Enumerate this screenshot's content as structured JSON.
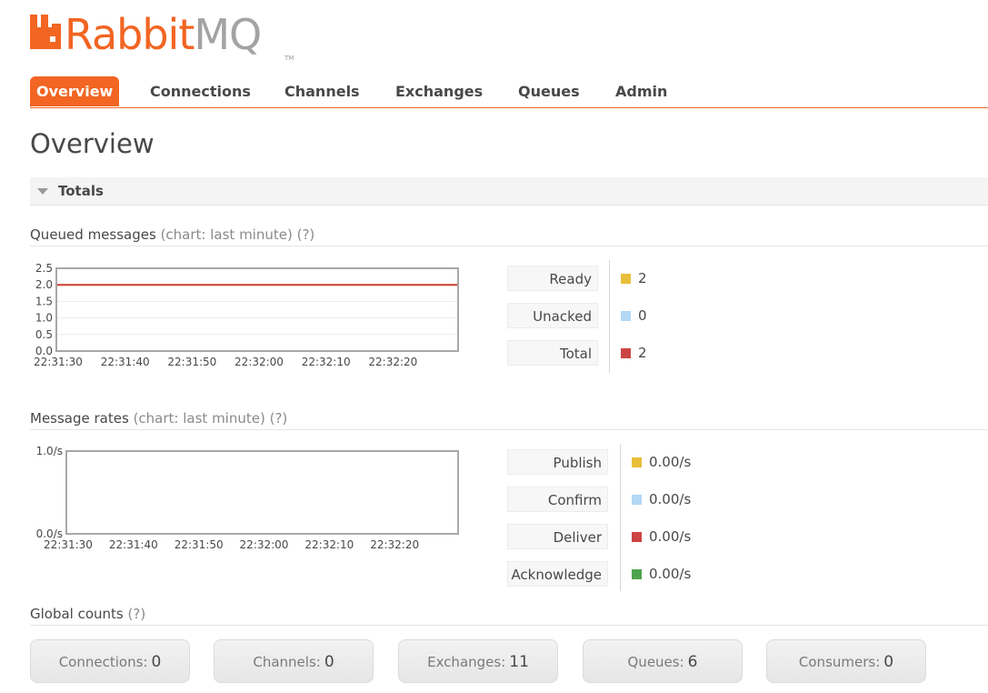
{
  "brand": {
    "name_primary": "Rabbit",
    "name_secondary": "MQ",
    "tm": "TM",
    "accent": "#f26522"
  },
  "nav": {
    "tabs": [
      {
        "label": "Overview",
        "active": true
      },
      {
        "label": "Connections"
      },
      {
        "label": "Channels"
      },
      {
        "label": "Exchanges"
      },
      {
        "label": "Queues"
      },
      {
        "label": "Admin"
      }
    ]
  },
  "page": {
    "title": "Overview"
  },
  "totals": {
    "label": "Totals",
    "queued": {
      "title": "Queued messages",
      "meta": "(chart: last minute)",
      "help": "(?)",
      "legend": [
        {
          "label": "Ready",
          "value": "2",
          "color": "#e9be3a"
        },
        {
          "label": "Unacked",
          "value": "0",
          "color": "#b3d7f5"
        },
        {
          "label": "Total",
          "value": "2",
          "color": "#cc4444"
        }
      ]
    },
    "rates": {
      "title": "Message rates",
      "meta": "(chart: last minute)",
      "help": "(?)",
      "legend": [
        {
          "label": "Publish",
          "value": "0.00/s",
          "color": "#e9be3a"
        },
        {
          "label": "Confirm",
          "value": "0.00/s",
          "color": "#b3d7f5"
        },
        {
          "label": "Deliver",
          "value": "0.00/s",
          "color": "#cc4444"
        },
        {
          "label": "Acknowledge",
          "value": "0.00/s",
          "color": "#4ea34c"
        }
      ]
    }
  },
  "global_counts": {
    "title": "Global counts",
    "help": "(?)",
    "items": [
      {
        "label": "Connections:",
        "value": "0"
      },
      {
        "label": "Channels:",
        "value": "0"
      },
      {
        "label": "Exchanges:",
        "value": "11"
      },
      {
        "label": "Queues:",
        "value": "6"
      },
      {
        "label": "Consumers:",
        "value": "0"
      }
    ]
  },
  "chart_data": [
    {
      "type": "line",
      "x": [
        "22:31:30",
        "22:31:40",
        "22:31:50",
        "22:32:00",
        "22:32:10",
        "22:32:20"
      ],
      "y_ticks": [
        "0.0",
        "0.5",
        "1.0",
        "1.5",
        "2.0",
        "2.5"
      ],
      "ylim": [
        0,
        2.5
      ],
      "grid": true,
      "series": [
        {
          "name": "Ready",
          "color": "#e9be3a",
          "values": [
            2,
            2,
            2,
            2,
            2,
            2
          ]
        },
        {
          "name": "Unacked",
          "color": "#b3d7f5",
          "values": [
            0,
            0,
            0,
            0,
            0,
            0
          ]
        },
        {
          "name": "Total",
          "color": "#cc4444",
          "values": [
            2,
            2,
            2,
            2,
            2,
            2
          ]
        }
      ]
    },
    {
      "type": "line",
      "x": [
        "22:31:30",
        "22:31:40",
        "22:31:50",
        "22:32:00",
        "22:32:10",
        "22:32:20"
      ],
      "y_ticks": [
        "0.0/s",
        "1.0/s"
      ],
      "ylim": [
        0,
        1
      ],
      "grid": false,
      "series": [
        {
          "name": "Publish",
          "color": "#e9be3a",
          "values": [
            0,
            0,
            0,
            0,
            0,
            0
          ]
        },
        {
          "name": "Confirm",
          "color": "#b3d7f5",
          "values": [
            0,
            0,
            0,
            0,
            0,
            0
          ]
        },
        {
          "name": "Deliver",
          "color": "#cc4444",
          "values": [
            0,
            0,
            0,
            0,
            0,
            0
          ]
        },
        {
          "name": "Acknowledge",
          "color": "#4ea34c",
          "values": [
            0,
            0,
            0,
            0,
            0,
            0
          ]
        }
      ]
    }
  ]
}
